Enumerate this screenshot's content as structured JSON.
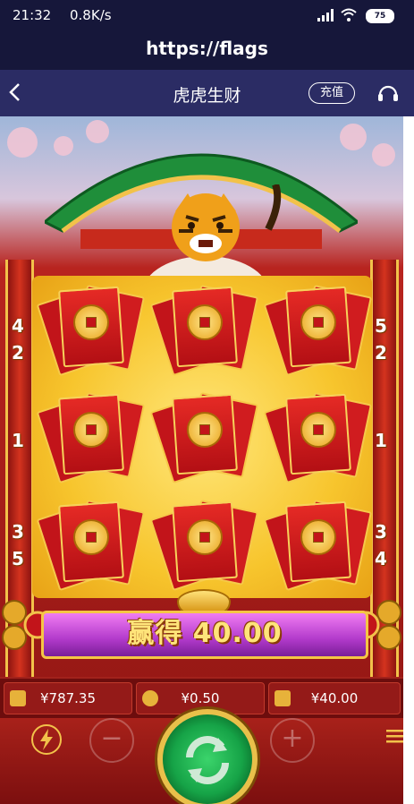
{
  "status_bar": {
    "time": "21:32",
    "net_speed": "0.8K/s",
    "battery": "75"
  },
  "url_bar": {
    "url": "https://flags"
  },
  "nav": {
    "title": "虎虎生财",
    "recharge_label": "充值"
  },
  "game": {
    "reels": [
      [
        "red-envelope",
        "red-envelope",
        "red-envelope"
      ],
      [
        "red-envelope",
        "red-envelope",
        "red-envelope"
      ],
      [
        "red-envelope",
        "red-envelope",
        "red-envelope"
      ]
    ],
    "left_ways": [
      "4",
      "2",
      "1",
      "3",
      "5"
    ],
    "right_ways": [
      "5",
      "2",
      "1",
      "3",
      "4"
    ],
    "win_text": "赢得 40.00"
  },
  "info": {
    "balance": "¥787.35",
    "bet": "¥0.50",
    "win": "¥40.00"
  },
  "colors": {
    "status_bg": "#16173a",
    "nav_bg": "#2b2c64",
    "spin_green": "#16a347",
    "gold": "#f5c645"
  }
}
